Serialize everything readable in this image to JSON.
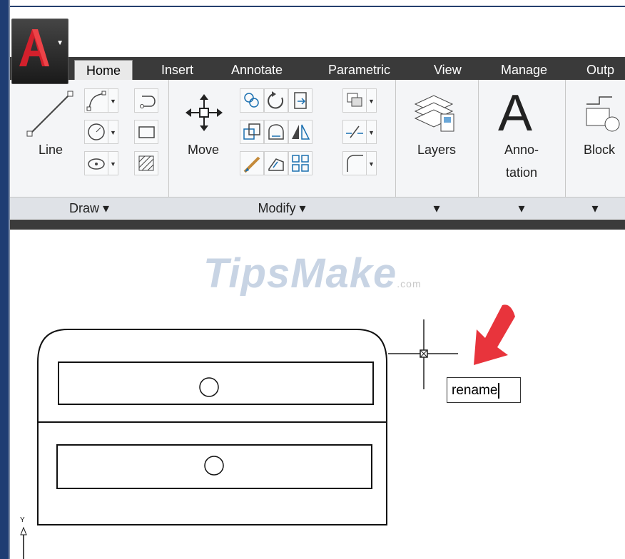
{
  "ribbon": {
    "tabs": [
      "Home",
      "Insert",
      "Annotate",
      "Parametric",
      "View",
      "Manage",
      "Outp"
    ],
    "panels": {
      "draw": {
        "title": "Draw",
        "line_label": "Line"
      },
      "modify": {
        "title": "Modify",
        "move_label": "Move"
      },
      "layers": {
        "label": "Layers"
      },
      "annotation": {
        "label_line1": "Anno-",
        "label_line2": "tation",
        "glyph": "A"
      },
      "block": {
        "label": "Block"
      }
    }
  },
  "watermark": {
    "brand": "TipsMake",
    "tld": ".com"
  },
  "command": {
    "input_value": "rename"
  },
  "ucs": {
    "y_label": "Y"
  },
  "colors": {
    "arrow": "#e8343c",
    "tab_bar": "#3a3a3a",
    "ribbon": "#f4f5f7"
  }
}
